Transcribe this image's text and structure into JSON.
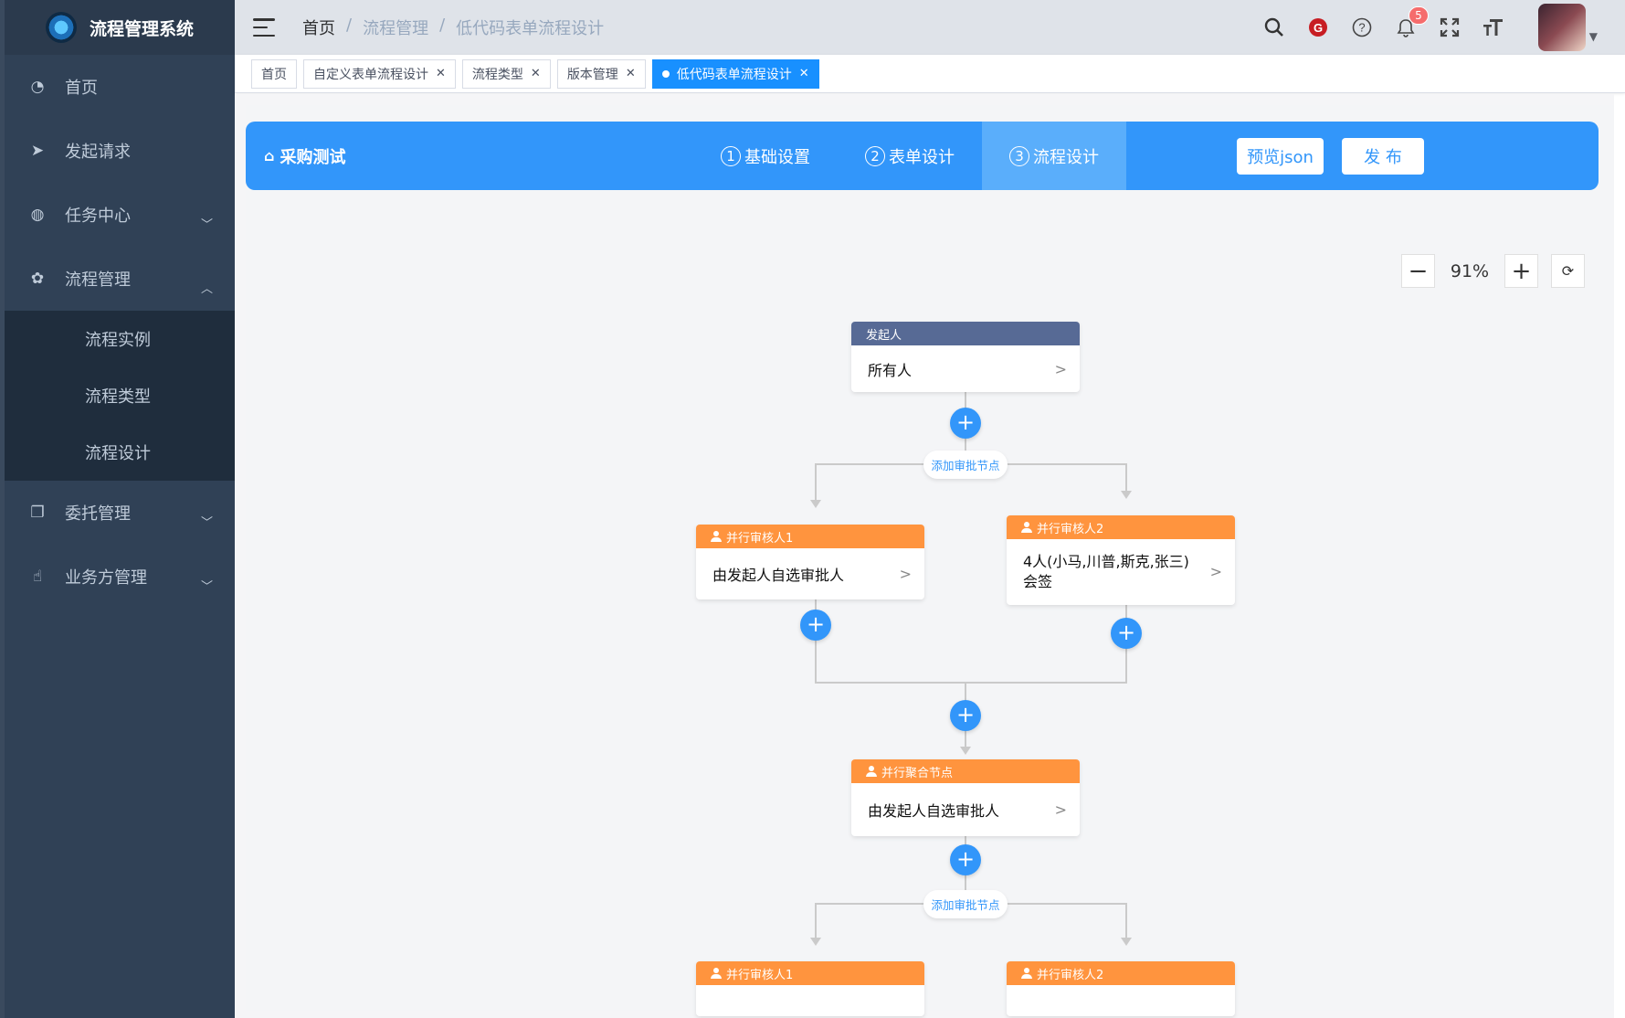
{
  "app": {
    "title": "流程管理系统"
  },
  "sidebar": {
    "items": [
      {
        "label": "首页",
        "icon": "dashboard-icon"
      },
      {
        "label": "发起请求",
        "icon": "send-icon"
      },
      {
        "label": "任务中心",
        "icon": "task-icon"
      },
      {
        "label": "流程管理",
        "icon": "gear-icon"
      },
      {
        "label": "委托管理",
        "icon": "copy-icon"
      },
      {
        "label": "业务方管理",
        "icon": "hand-icon"
      }
    ],
    "sub_items": [
      "流程实例",
      "流程类型",
      "流程设计"
    ]
  },
  "header": {
    "breadcrumb": [
      "首页",
      "流程管理",
      "低代码表单流程设计"
    ],
    "badge_count": "5"
  },
  "tags": [
    "首页",
    "自定义表单流程设计",
    "流程类型",
    "版本管理",
    "低代码表单流程设计"
  ],
  "designer": {
    "process_name": "采购测试",
    "steps": [
      {
        "num": "1",
        "label": "基础设置"
      },
      {
        "num": "2",
        "label": "表单设计"
      },
      {
        "num": "3",
        "label": "流程设计"
      }
    ],
    "preview_label": "预览json",
    "publish_label": "发 布",
    "zoom": "91%"
  },
  "flow": {
    "add_branch": "添加审批节点",
    "start": {
      "title": "发起人",
      "body": "所有人"
    },
    "branch1": {
      "title": "并行审核人1",
      "body": "由发起人自选审批人"
    },
    "branch2": {
      "title": "并行审核人2",
      "body": "4人(小马,川普,斯克,张三)会签"
    },
    "join": {
      "title": "并行聚合节点",
      "body": "由发起人自选审批人"
    },
    "branch3": {
      "title": "并行审核人1"
    },
    "branch4": {
      "title": "并行审核人2"
    }
  }
}
